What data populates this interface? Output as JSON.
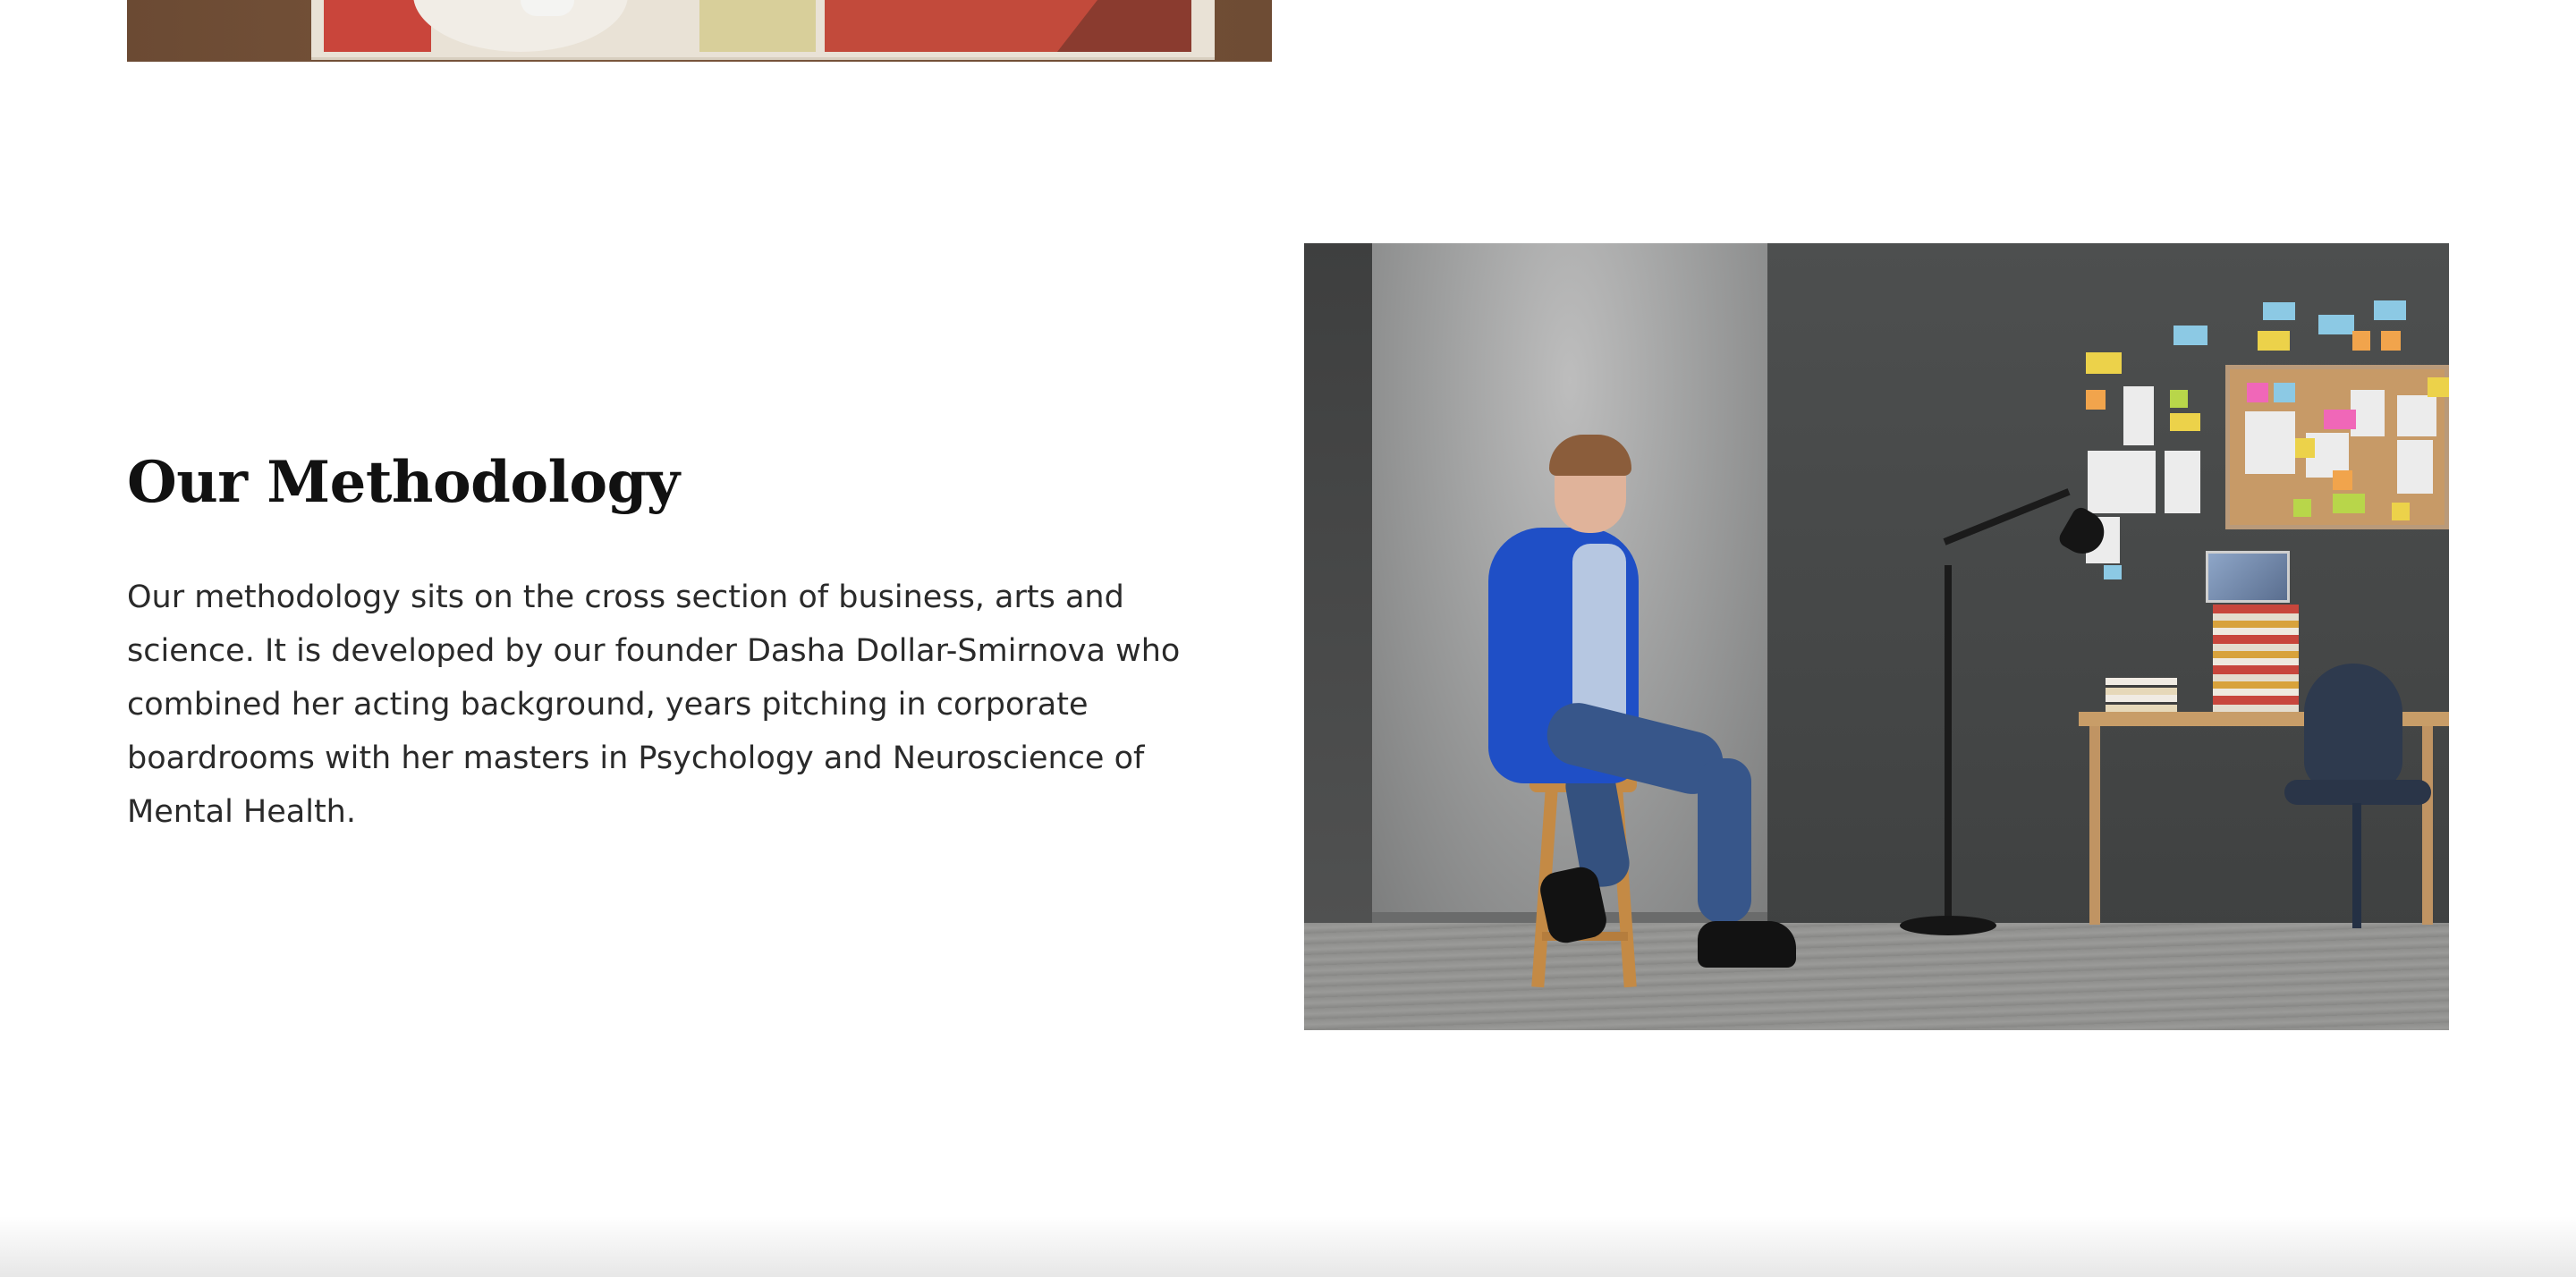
{
  "top_image": {
    "icon": "floor-rug-photo"
  },
  "methodology": {
    "heading": "Our Methodology",
    "body_lines": [
      "Our methodology sits on the cross section of business, arts and",
      "science. It is developed by our founder Dasha Dollar-Smirnova who",
      "combined her acting background, years pitching in corporate",
      "boardrooms with her masters in Psychology and Neuroscience of",
      "Mental Health."
    ],
    "photo_icon": "woman-seated-on-stool-photo"
  },
  "colors": {
    "background": "#ffffff",
    "heading": "#111111",
    "body_text": "#2a2a2a",
    "jacket_blue": "#1f4fc6"
  }
}
